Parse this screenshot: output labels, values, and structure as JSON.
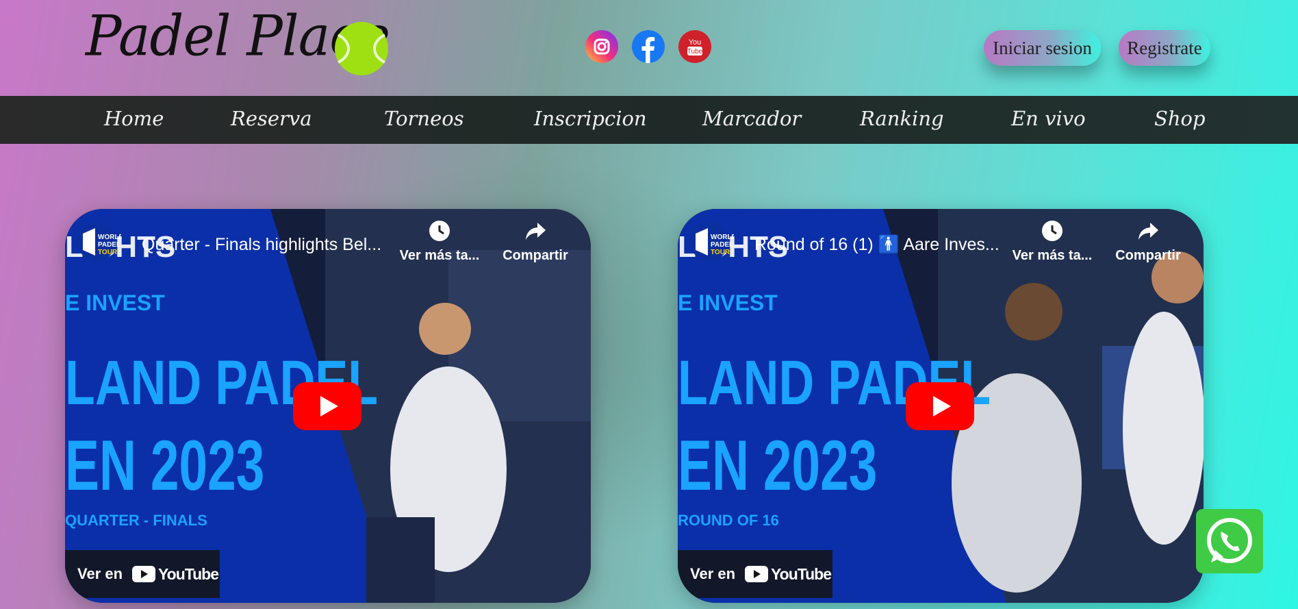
{
  "header": {
    "logo_text": "Padel Place",
    "social": [
      {
        "name": "instagram-icon"
      },
      {
        "name": "facebook-icon"
      },
      {
        "name": "youtube-icon",
        "text": "You Tube"
      }
    ],
    "login_label": "Iniciar sesion",
    "register_label": "Registrate"
  },
  "nav": {
    "items": [
      "Home",
      "Reserva",
      "Torneos",
      "Inscripcion",
      "Marcador",
      "Ranking",
      "En vivo",
      "Shop"
    ]
  },
  "videos": [
    {
      "title": "Quarter - Finals highlights Bel...",
      "watch_later": "Ver más ta...",
      "share": "Compartir",
      "watch_on": "Ver en",
      "youtube": "YouTube",
      "thumb_lines": [
        "E INVEST",
        "LAND PADEL",
        "EN 2023",
        "QUARTER - FINALS"
      ],
      "top_left_text": "LIGHTS"
    },
    {
      "title": "Round of 16 (1) 🚹 Aare Inves...",
      "watch_later": "Ver más ta...",
      "share": "Compartir",
      "watch_on": "Ver en",
      "youtube": "YouTube",
      "thumb_lines": [
        "E INVEST",
        "LAND PADEL",
        "EN 2023",
        "ROUND OF 16"
      ],
      "top_left_text": "LIGHTS"
    }
  ],
  "colors": {
    "nav_bg": "#222222",
    "accent_cyan": "#2ff5e3",
    "accent_pink": "#c878c8",
    "video_blue": "#0b2fa8",
    "video_text_blue": "#1aa3ff",
    "youtube_red": "#ff0000",
    "whatsapp_green": "#3fcb46"
  },
  "floating": {
    "whatsapp": "whatsapp-icon"
  }
}
